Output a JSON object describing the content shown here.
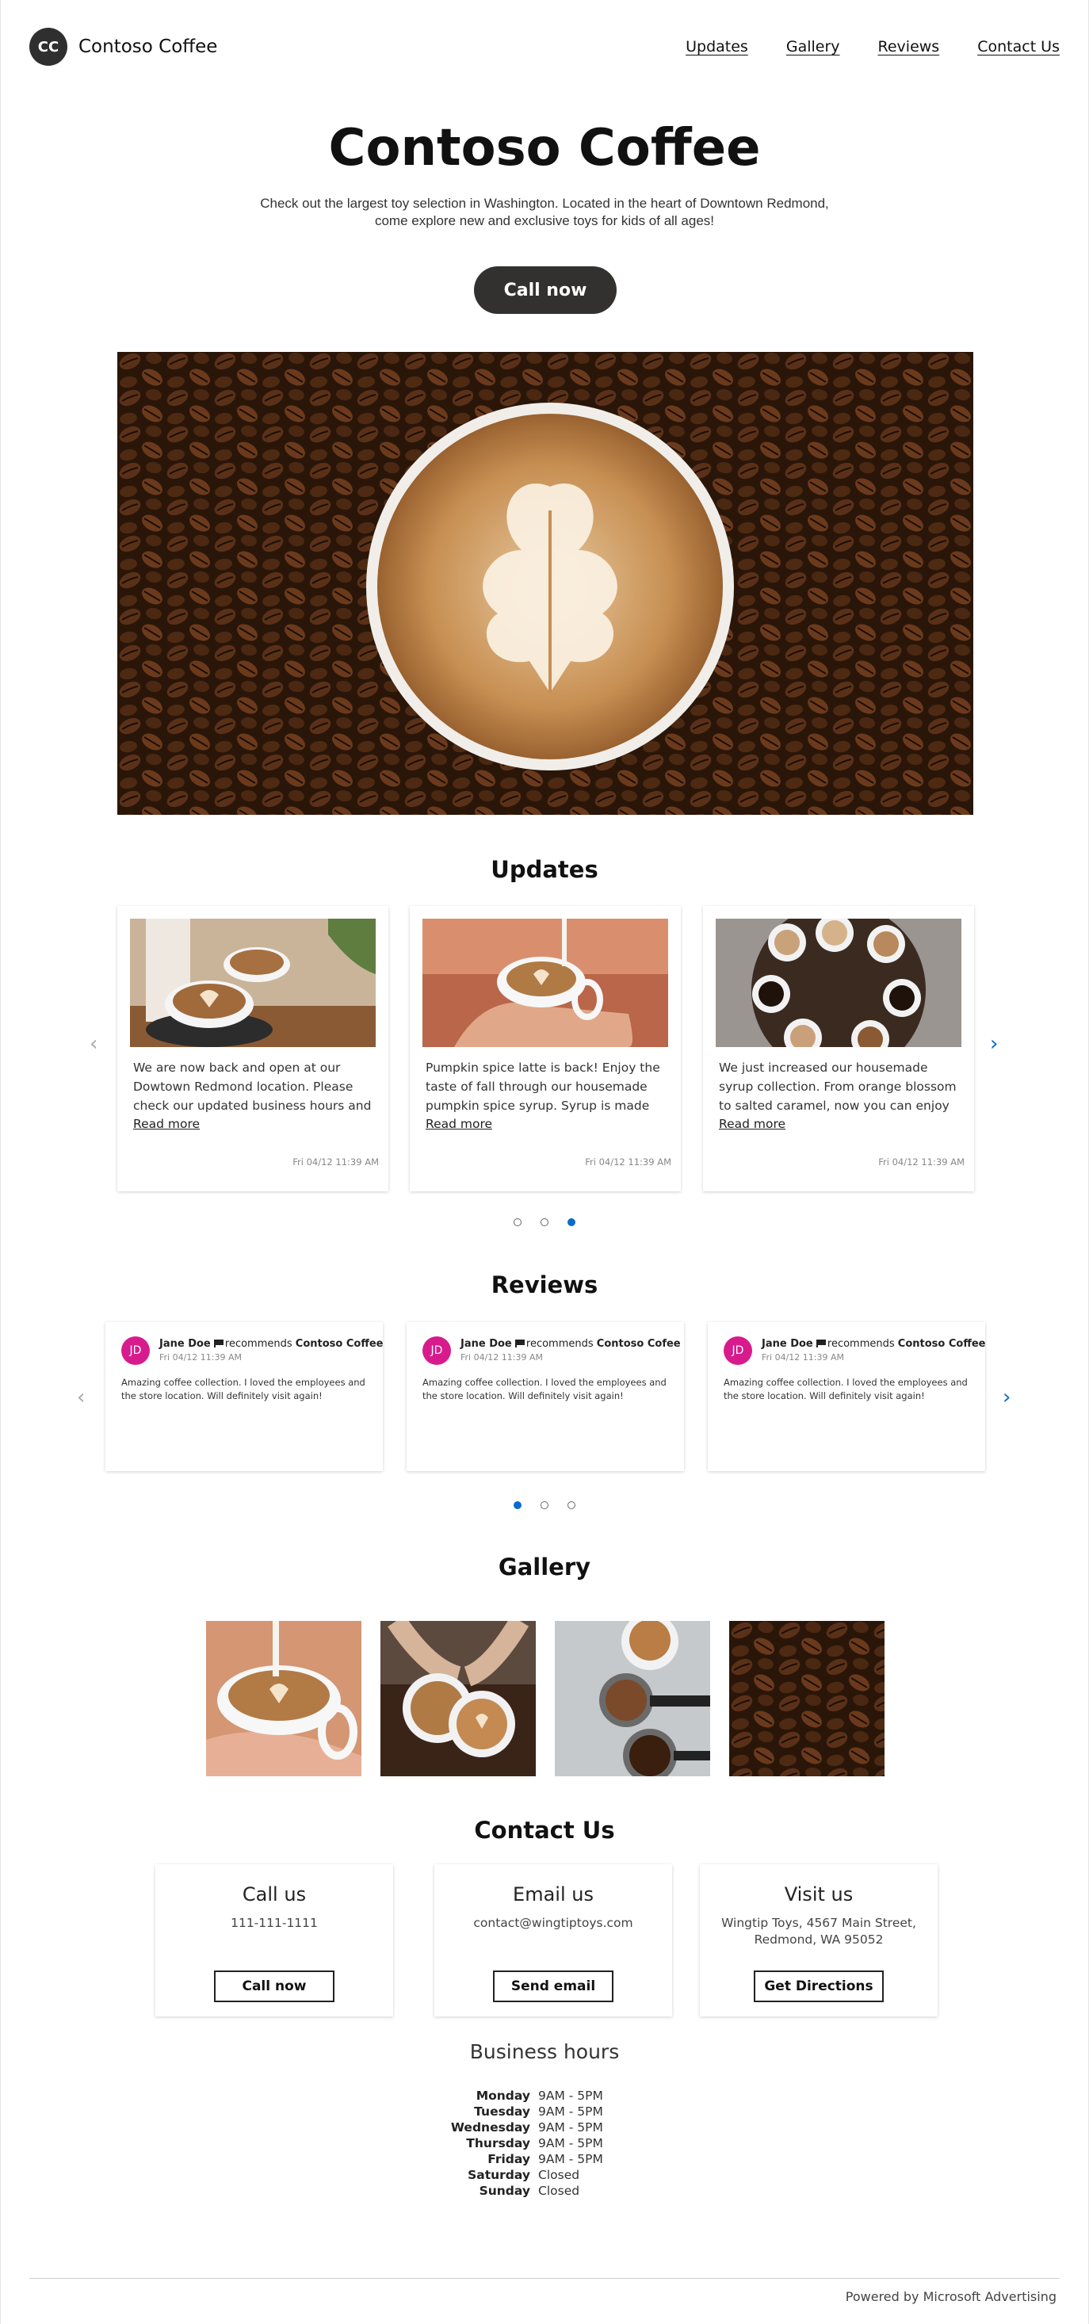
{
  "header": {
    "logo_initials": "CC",
    "brand_name": "Contoso Coffee",
    "nav": [
      "Updates",
      "Gallery",
      "Reviews",
      "Contact Us"
    ]
  },
  "hero": {
    "title": "Contoso Coffee",
    "description": "Check out the largest toy selection in Washington. Located in the heart of Downtown Redmond, come explore new and exclusive toys for kids of all ages!",
    "cta_label": "Call now"
  },
  "updates": {
    "title": "Updates",
    "cards": [
      {
        "text": "We are now back and open at our Dowtown Redmond location. Please check our updated business hours and stop by for our upgraded coffee collection! We...",
        "read_more": "Read more",
        "date": "Fri 04/12 11:39 AM"
      },
      {
        "text": "Pumpkin spice latte is back! Enjoy the taste of fall through our housemade pumpkin spice syrup. Syrup is made from scratch and it contains pumpkin puree w...",
        "read_more": "Read more",
        "date": "Fri 04/12 11:39 AM"
      },
      {
        "text": "We just increased our housemade syrup collection. From orange blossom to salted caramel, now you can enjoy your latte in many different ways...",
        "read_more": "Read more",
        "date": "Fri 04/12 11:39 AM"
      }
    ],
    "active_dot": 2
  },
  "reviews": {
    "title": "Reviews",
    "cards": [
      {
        "initials": "JD",
        "name": "Jane Doe",
        "verb": "recommends",
        "business": "Contoso Coffee",
        "date": "Fri 04/12 11:39 AM",
        "text": "Amazing coffee collection. I loved the employees and the store location. Will definitely visit again!"
      },
      {
        "initials": "JD",
        "name": "Jane Doe",
        "verb": "recommends",
        "business": "Contoso Cofee",
        "date": "Fri 04/12 11:39 AM",
        "text": "Amazing coffee collection. I loved the employees and the store location. Will definitely visit again!"
      },
      {
        "initials": "JD",
        "name": "Jane Doe",
        "verb": "recommends",
        "business": "Contoso Coffee",
        "date": "Fri 04/12 11:39 AM",
        "text": "Amazing coffee collection. I loved the employees and the store location. Will definitely visit again!"
      }
    ],
    "active_dot": 0
  },
  "gallery": {
    "title": "Gallery"
  },
  "contact": {
    "title": "Contact Us",
    "cards": [
      {
        "title": "Call us",
        "info": "111-111-1111",
        "button": "Call now"
      },
      {
        "title": "Email us",
        "info": "contact@wingtiptoys.com",
        "button": "Send email"
      },
      {
        "title": "Visit us",
        "info": "Wingtip Toys, 4567 Main Street, Redmond, WA 95052",
        "button": "Get Directions"
      }
    ]
  },
  "hours": {
    "title": "Business hours",
    "rows": [
      {
        "day": "Monday",
        "time": "9AM - 5PM"
      },
      {
        "day": "Tuesday",
        "time": "9AM - 5PM"
      },
      {
        "day": "Wednesday",
        "time": "9AM - 5PM"
      },
      {
        "day": "Thursday",
        "time": "9AM - 5PM"
      },
      {
        "day": "Friday",
        "time": "9AM - 5PM"
      },
      {
        "day": "Saturday",
        "time": "Closed"
      },
      {
        "day": "Sunday",
        "time": "Closed"
      }
    ]
  },
  "footer": {
    "text": "Powered by Microsoft Advertising"
  },
  "colors": {
    "accent": "#0b6bcb",
    "avatar": "#d81b8c",
    "dark_button": "#323130"
  }
}
